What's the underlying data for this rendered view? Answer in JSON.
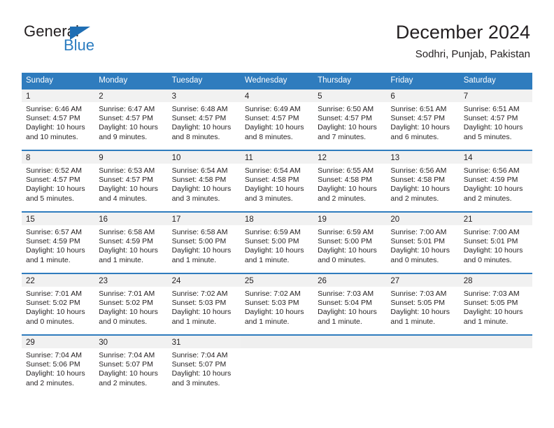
{
  "brand": {
    "name_top": "General",
    "name_bottom": "Blue",
    "accent_color": "#2b7cc0",
    "triangle_color": "#1f6eb4"
  },
  "header": {
    "title": "December 2024",
    "subtitle": "Sodhri, Punjab, Pakistan"
  },
  "calendar": {
    "header_bg": "#2f7cbe",
    "header_text_color": "#ffffff",
    "daynum_band_bg": "#f1f1f1",
    "weekdays": [
      "Sunday",
      "Monday",
      "Tuesday",
      "Wednesday",
      "Thursday",
      "Friday",
      "Saturday"
    ],
    "weeks": [
      [
        {
          "day": "1",
          "sunrise": "Sunrise: 6:46 AM",
          "sunset": "Sunset: 4:57 PM",
          "daylight_1": "Daylight: 10 hours",
          "daylight_2": "and 10 minutes."
        },
        {
          "day": "2",
          "sunrise": "Sunrise: 6:47 AM",
          "sunset": "Sunset: 4:57 PM",
          "daylight_1": "Daylight: 10 hours",
          "daylight_2": "and 9 minutes."
        },
        {
          "day": "3",
          "sunrise": "Sunrise: 6:48 AM",
          "sunset": "Sunset: 4:57 PM",
          "daylight_1": "Daylight: 10 hours",
          "daylight_2": "and 8 minutes."
        },
        {
          "day": "4",
          "sunrise": "Sunrise: 6:49 AM",
          "sunset": "Sunset: 4:57 PM",
          "daylight_1": "Daylight: 10 hours",
          "daylight_2": "and 8 minutes."
        },
        {
          "day": "5",
          "sunrise": "Sunrise: 6:50 AM",
          "sunset": "Sunset: 4:57 PM",
          "daylight_1": "Daylight: 10 hours",
          "daylight_2": "and 7 minutes."
        },
        {
          "day": "6",
          "sunrise": "Sunrise: 6:51 AM",
          "sunset": "Sunset: 4:57 PM",
          "daylight_1": "Daylight: 10 hours",
          "daylight_2": "and 6 minutes."
        },
        {
          "day": "7",
          "sunrise": "Sunrise: 6:51 AM",
          "sunset": "Sunset: 4:57 PM",
          "daylight_1": "Daylight: 10 hours",
          "daylight_2": "and 5 minutes."
        }
      ],
      [
        {
          "day": "8",
          "sunrise": "Sunrise: 6:52 AM",
          "sunset": "Sunset: 4:57 PM",
          "daylight_1": "Daylight: 10 hours",
          "daylight_2": "and 5 minutes."
        },
        {
          "day": "9",
          "sunrise": "Sunrise: 6:53 AM",
          "sunset": "Sunset: 4:57 PM",
          "daylight_1": "Daylight: 10 hours",
          "daylight_2": "and 4 minutes."
        },
        {
          "day": "10",
          "sunrise": "Sunrise: 6:54 AM",
          "sunset": "Sunset: 4:58 PM",
          "daylight_1": "Daylight: 10 hours",
          "daylight_2": "and 3 minutes."
        },
        {
          "day": "11",
          "sunrise": "Sunrise: 6:54 AM",
          "sunset": "Sunset: 4:58 PM",
          "daylight_1": "Daylight: 10 hours",
          "daylight_2": "and 3 minutes."
        },
        {
          "day": "12",
          "sunrise": "Sunrise: 6:55 AM",
          "sunset": "Sunset: 4:58 PM",
          "daylight_1": "Daylight: 10 hours",
          "daylight_2": "and 2 minutes."
        },
        {
          "day": "13",
          "sunrise": "Sunrise: 6:56 AM",
          "sunset": "Sunset: 4:58 PM",
          "daylight_1": "Daylight: 10 hours",
          "daylight_2": "and 2 minutes."
        },
        {
          "day": "14",
          "sunrise": "Sunrise: 6:56 AM",
          "sunset": "Sunset: 4:59 PM",
          "daylight_1": "Daylight: 10 hours",
          "daylight_2": "and 2 minutes."
        }
      ],
      [
        {
          "day": "15",
          "sunrise": "Sunrise: 6:57 AM",
          "sunset": "Sunset: 4:59 PM",
          "daylight_1": "Daylight: 10 hours",
          "daylight_2": "and 1 minute."
        },
        {
          "day": "16",
          "sunrise": "Sunrise: 6:58 AM",
          "sunset": "Sunset: 4:59 PM",
          "daylight_1": "Daylight: 10 hours",
          "daylight_2": "and 1 minute."
        },
        {
          "day": "17",
          "sunrise": "Sunrise: 6:58 AM",
          "sunset": "Sunset: 5:00 PM",
          "daylight_1": "Daylight: 10 hours",
          "daylight_2": "and 1 minute."
        },
        {
          "day": "18",
          "sunrise": "Sunrise: 6:59 AM",
          "sunset": "Sunset: 5:00 PM",
          "daylight_1": "Daylight: 10 hours",
          "daylight_2": "and 1 minute."
        },
        {
          "day": "19",
          "sunrise": "Sunrise: 6:59 AM",
          "sunset": "Sunset: 5:00 PM",
          "daylight_1": "Daylight: 10 hours",
          "daylight_2": "and 0 minutes."
        },
        {
          "day": "20",
          "sunrise": "Sunrise: 7:00 AM",
          "sunset": "Sunset: 5:01 PM",
          "daylight_1": "Daylight: 10 hours",
          "daylight_2": "and 0 minutes."
        },
        {
          "day": "21",
          "sunrise": "Sunrise: 7:00 AM",
          "sunset": "Sunset: 5:01 PM",
          "daylight_1": "Daylight: 10 hours",
          "daylight_2": "and 0 minutes."
        }
      ],
      [
        {
          "day": "22",
          "sunrise": "Sunrise: 7:01 AM",
          "sunset": "Sunset: 5:02 PM",
          "daylight_1": "Daylight: 10 hours",
          "daylight_2": "and 0 minutes."
        },
        {
          "day": "23",
          "sunrise": "Sunrise: 7:01 AM",
          "sunset": "Sunset: 5:02 PM",
          "daylight_1": "Daylight: 10 hours",
          "daylight_2": "and 0 minutes."
        },
        {
          "day": "24",
          "sunrise": "Sunrise: 7:02 AM",
          "sunset": "Sunset: 5:03 PM",
          "daylight_1": "Daylight: 10 hours",
          "daylight_2": "and 1 minute."
        },
        {
          "day": "25",
          "sunrise": "Sunrise: 7:02 AM",
          "sunset": "Sunset: 5:03 PM",
          "daylight_1": "Daylight: 10 hours",
          "daylight_2": "and 1 minute."
        },
        {
          "day": "26",
          "sunrise": "Sunrise: 7:03 AM",
          "sunset": "Sunset: 5:04 PM",
          "daylight_1": "Daylight: 10 hours",
          "daylight_2": "and 1 minute."
        },
        {
          "day": "27",
          "sunrise": "Sunrise: 7:03 AM",
          "sunset": "Sunset: 5:05 PM",
          "daylight_1": "Daylight: 10 hours",
          "daylight_2": "and 1 minute."
        },
        {
          "day": "28",
          "sunrise": "Sunrise: 7:03 AM",
          "sunset": "Sunset: 5:05 PM",
          "daylight_1": "Daylight: 10 hours",
          "daylight_2": "and 1 minute."
        }
      ],
      [
        {
          "day": "29",
          "sunrise": "Sunrise: 7:04 AM",
          "sunset": "Sunset: 5:06 PM",
          "daylight_1": "Daylight: 10 hours",
          "daylight_2": "and 2 minutes."
        },
        {
          "day": "30",
          "sunrise": "Sunrise: 7:04 AM",
          "sunset": "Sunset: 5:07 PM",
          "daylight_1": "Daylight: 10 hours",
          "daylight_2": "and 2 minutes."
        },
        {
          "day": "31",
          "sunrise": "Sunrise: 7:04 AM",
          "sunset": "Sunset: 5:07 PM",
          "daylight_1": "Daylight: 10 hours",
          "daylight_2": "and 3 minutes."
        },
        {
          "day": "",
          "sunrise": "",
          "sunset": "",
          "daylight_1": "",
          "daylight_2": ""
        },
        {
          "day": "",
          "sunrise": "",
          "sunset": "",
          "daylight_1": "",
          "daylight_2": ""
        },
        {
          "day": "",
          "sunrise": "",
          "sunset": "",
          "daylight_1": "",
          "daylight_2": ""
        },
        {
          "day": "",
          "sunrise": "",
          "sunset": "",
          "daylight_1": "",
          "daylight_2": ""
        }
      ]
    ]
  }
}
